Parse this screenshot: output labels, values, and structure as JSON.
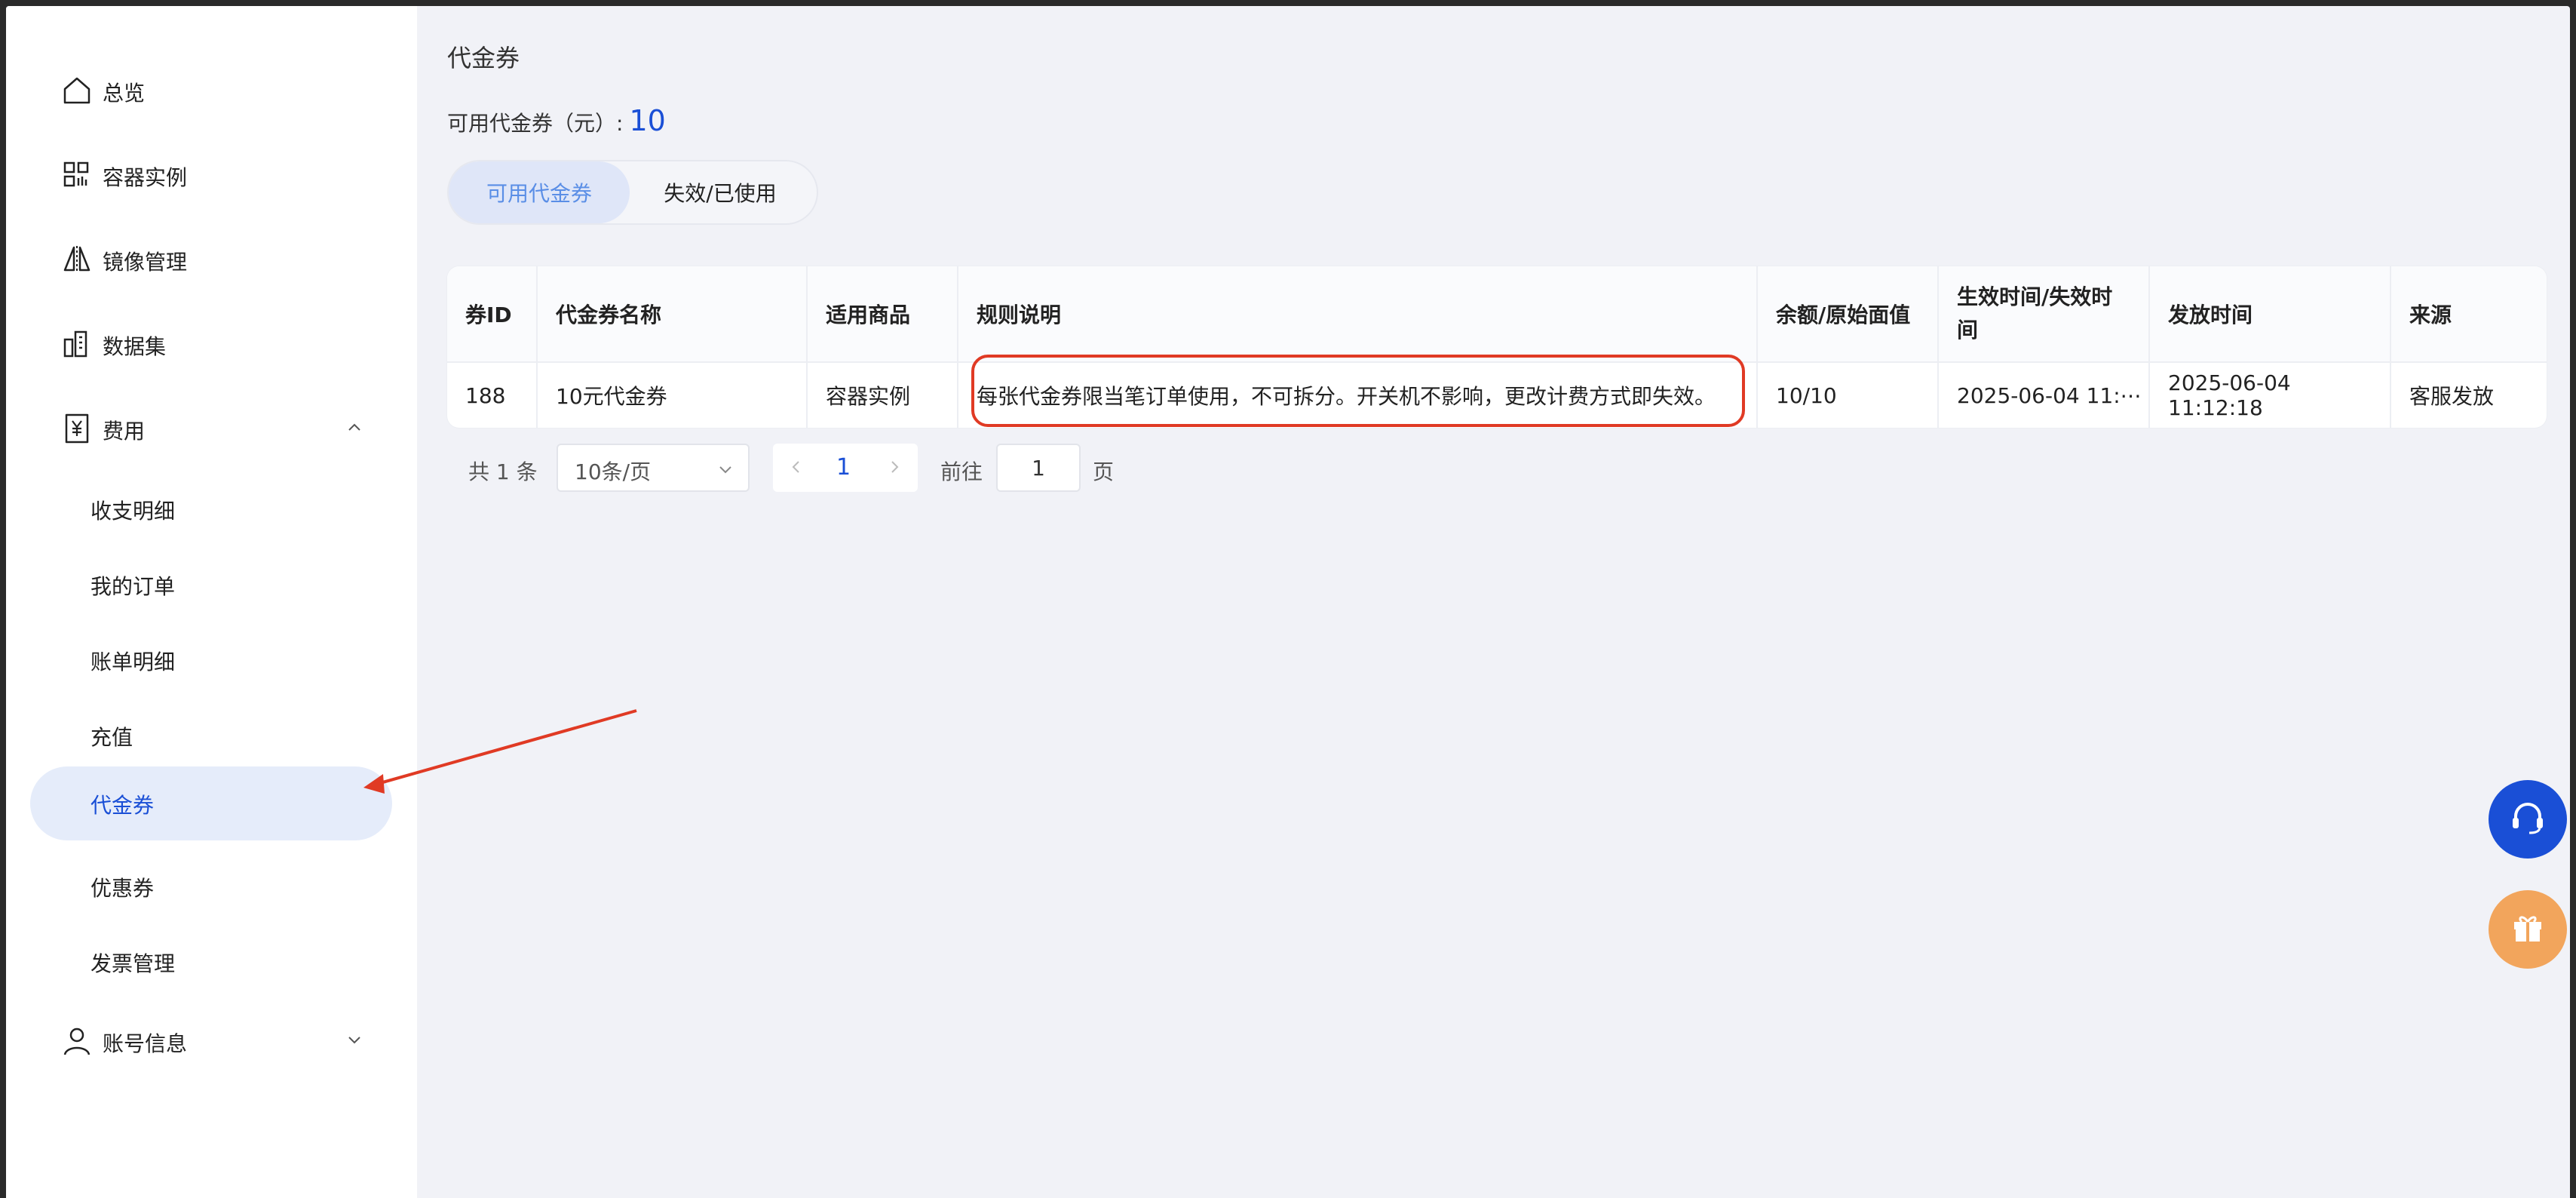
{
  "sidebar": {
    "items": [
      {
        "label": "总览",
        "icon": "home-icon"
      },
      {
        "label": "容器实例",
        "icon": "grid-icon"
      },
      {
        "label": "镜像管理",
        "icon": "mirror-icon"
      },
      {
        "label": "数据集",
        "icon": "dataset-icon"
      },
      {
        "label": "费用",
        "icon": "yen-icon"
      },
      {
        "label": "账号信息",
        "icon": "user-icon"
      }
    ],
    "sub_items": [
      {
        "label": "收支明细"
      },
      {
        "label": "我的订单"
      },
      {
        "label": "账单明细"
      },
      {
        "label": "充值"
      },
      {
        "label": "代金券"
      },
      {
        "label": "优惠券"
      },
      {
        "label": "发票管理"
      }
    ]
  },
  "main": {
    "title": "代金券",
    "balance_label": "可用代金券（元）:",
    "balance_value": "10",
    "tabs": [
      {
        "label": "可用代金券"
      },
      {
        "label": "失效/已使用"
      }
    ],
    "table": {
      "headers": [
        "券ID",
        "代金券名称",
        "适用商品",
        "规则说明",
        "余额/原始面值",
        "生效时间/失效时间",
        "发放时间",
        "来源"
      ],
      "rows": [
        [
          "188",
          "10元代金券",
          "容器实例",
          "每张代金券限当笔订单使用，不可拆分。开关机不影响，更改计费方式即失效。",
          "10/10",
          "2025-06-04 11:⋯",
          "2025-06-04 11:12:18",
          "客服发放"
        ]
      ]
    },
    "pagination": {
      "total": "共 1 条",
      "page_size": "10条/页",
      "current_page": "1",
      "goto_label": "前往",
      "goto_value": "1",
      "page_suffix": "页"
    }
  },
  "colors": {
    "accent": "#1a4fd6",
    "annotation": "#e03a24",
    "gift": "#f2a55c"
  }
}
